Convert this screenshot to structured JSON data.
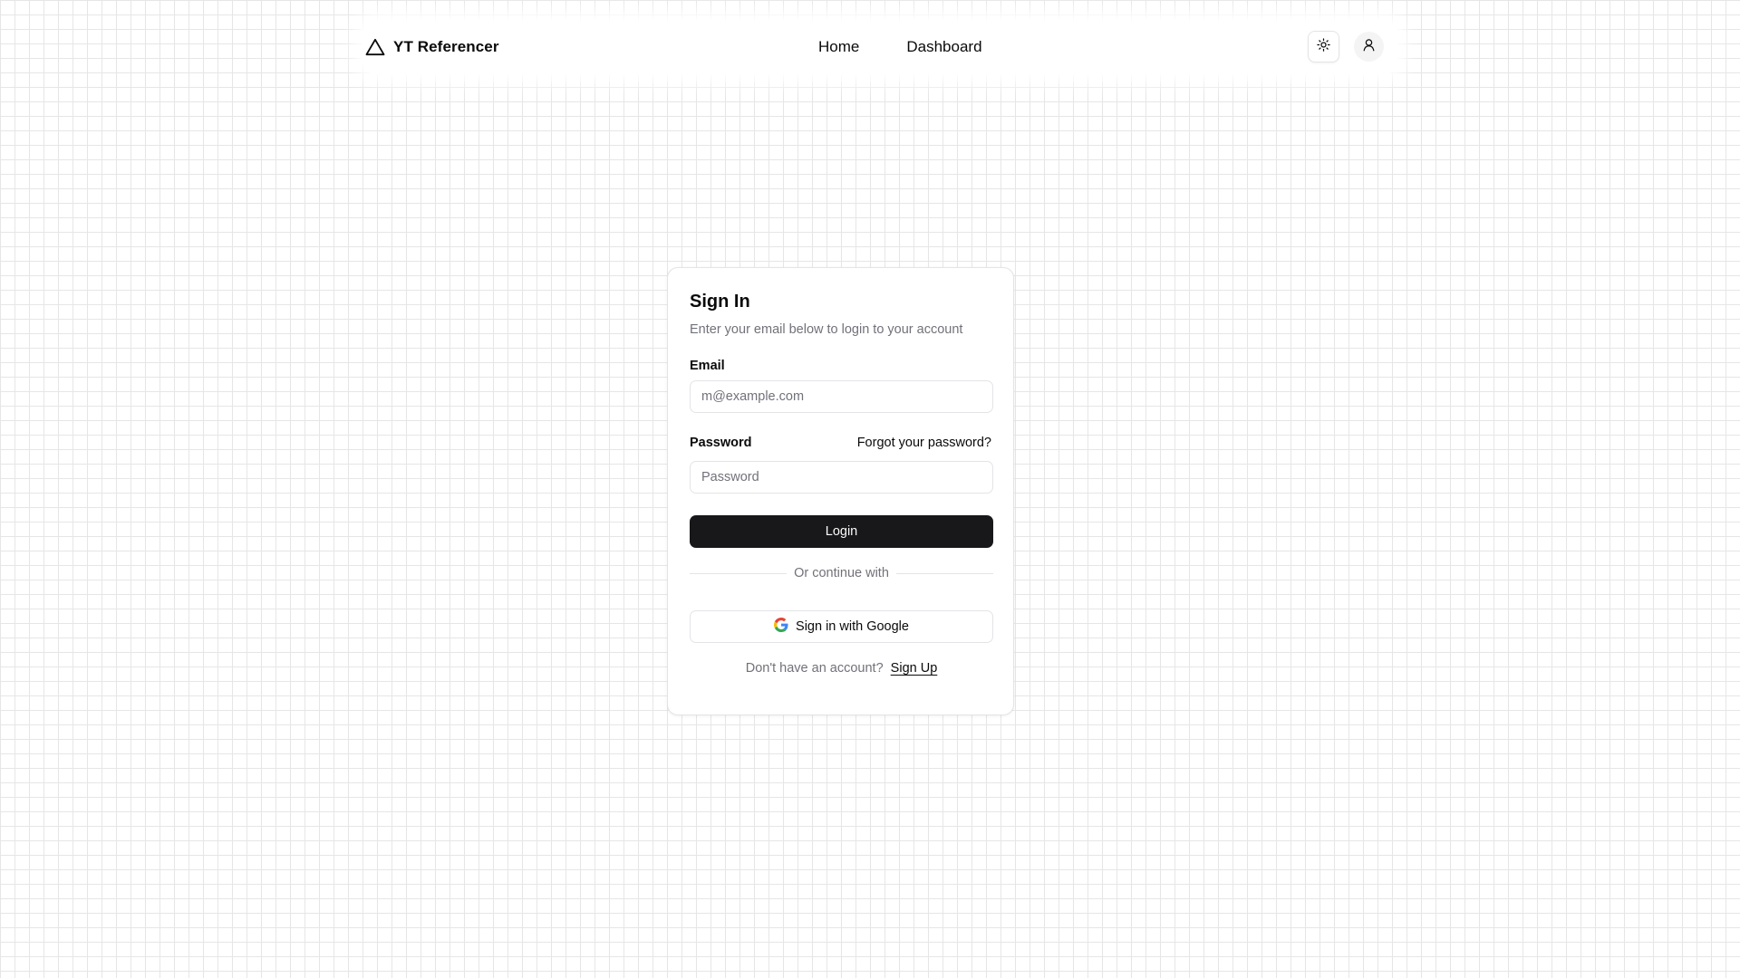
{
  "header": {
    "brand_name": "YT Referencer",
    "nav": [
      {
        "label": "Home"
      },
      {
        "label": "Dashboard"
      }
    ],
    "icons": {
      "brand": "triangle-logo-icon",
      "theme_toggle": "sun-icon",
      "user": "user-icon"
    }
  },
  "signin": {
    "title": "Sign In",
    "subtitle": "Enter your email below to login to your account",
    "email_label": "Email",
    "email_placeholder": "m@example.com",
    "email_value": "",
    "password_label": "Password",
    "forgot_link": "Forgot your password?",
    "password_placeholder": "Password",
    "password_value": "",
    "login_label": "Login",
    "divider_text": "Or continue with",
    "google_label": "Sign in with Google",
    "no_account_text": "Don't have an account?",
    "signup_link": "Sign Up"
  },
  "colors": {
    "primary": "#18181b",
    "muted_text": "#71717a",
    "border": "#e4e4e7",
    "grid_line": "#e6e6e6"
  }
}
